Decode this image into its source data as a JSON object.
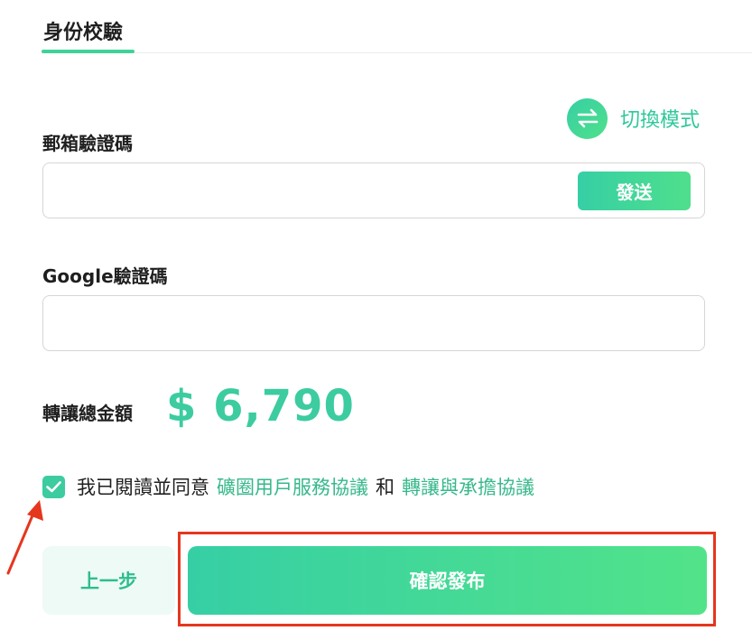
{
  "tabs": {
    "active_label": "身份校驗"
  },
  "switch_mode": {
    "label": "切換模式",
    "icon": "swap-arrows-icon"
  },
  "email_code": {
    "label": "郵箱驗證碼",
    "value": "",
    "placeholder": "",
    "send_label": "發送"
  },
  "google_code": {
    "label": "Google驗證碼",
    "value": "",
    "placeholder": ""
  },
  "total": {
    "label": "轉讓總金額",
    "amount": "$ 6,790"
  },
  "agreement": {
    "checked": true,
    "prefix": "我已閱讀並同意",
    "link1": "礦圈用戶服務協議",
    "conjunction": "和",
    "link2": "轉讓與承擔協議"
  },
  "actions": {
    "back_label": "上一步",
    "confirm_label": "確認發布"
  },
  "colors": {
    "accent": "#3ccc9f",
    "annotation_red": "#e5361e"
  }
}
